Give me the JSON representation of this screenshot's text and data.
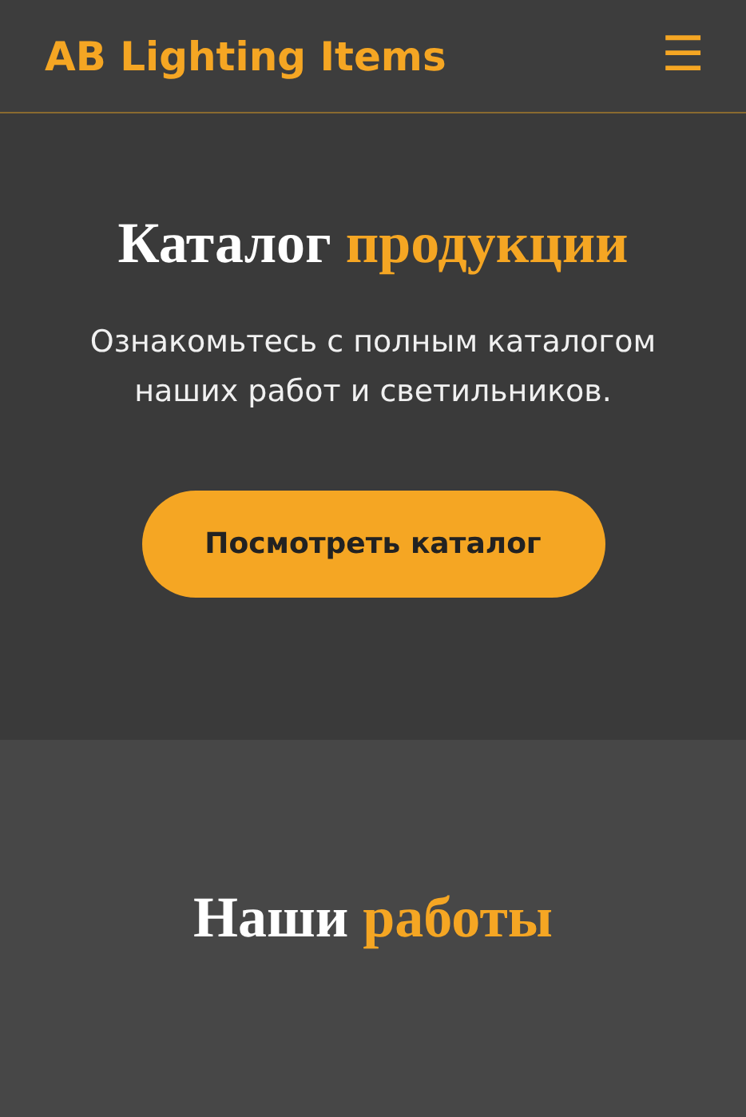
{
  "header": {
    "logo": "AB Lighting Items",
    "menu_icon": "☰"
  },
  "catalog": {
    "title": [
      {
        "text": "Каталог",
        "accent": false
      },
      {
        "text": "продукции",
        "accent": true
      }
    ],
    "description": "Ознакомьтесь с полным каталогом наших работ и светильников.",
    "button": "Посмотреть каталог"
  },
  "works": {
    "title": [
      {
        "text": "Наши",
        "accent": false
      },
      {
        "text": "работы",
        "accent": true
      }
    ]
  }
}
